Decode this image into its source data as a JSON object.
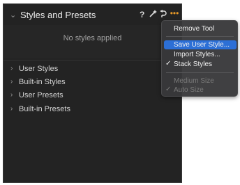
{
  "panel": {
    "title": "Styles and Presets",
    "header_icons": {
      "help": "?",
      "apply": "wand-icon",
      "reset": "undo-icon",
      "more": "more-icon"
    },
    "empty_message": "No styles applied",
    "sections": [
      {
        "label": "User Styles"
      },
      {
        "label": "Built-in Styles"
      },
      {
        "label": "User Presets"
      },
      {
        "label": "Built-in Presets"
      }
    ]
  },
  "menu": {
    "items": [
      {
        "label": "Remove Tool",
        "state": "normal"
      },
      {
        "label": "Save User Style...",
        "state": "highlighted"
      },
      {
        "label": "Import Styles...",
        "state": "normal"
      },
      {
        "label": "Stack Styles",
        "state": "checked"
      },
      {
        "label": "Medium Size",
        "state": "disabled"
      },
      {
        "label": "Auto Size",
        "state": "disabled-checked"
      }
    ]
  },
  "colors": {
    "panel_bg": "#232323",
    "accent_orange": "#e89a28",
    "highlight_blue": "#2c6fd6"
  }
}
